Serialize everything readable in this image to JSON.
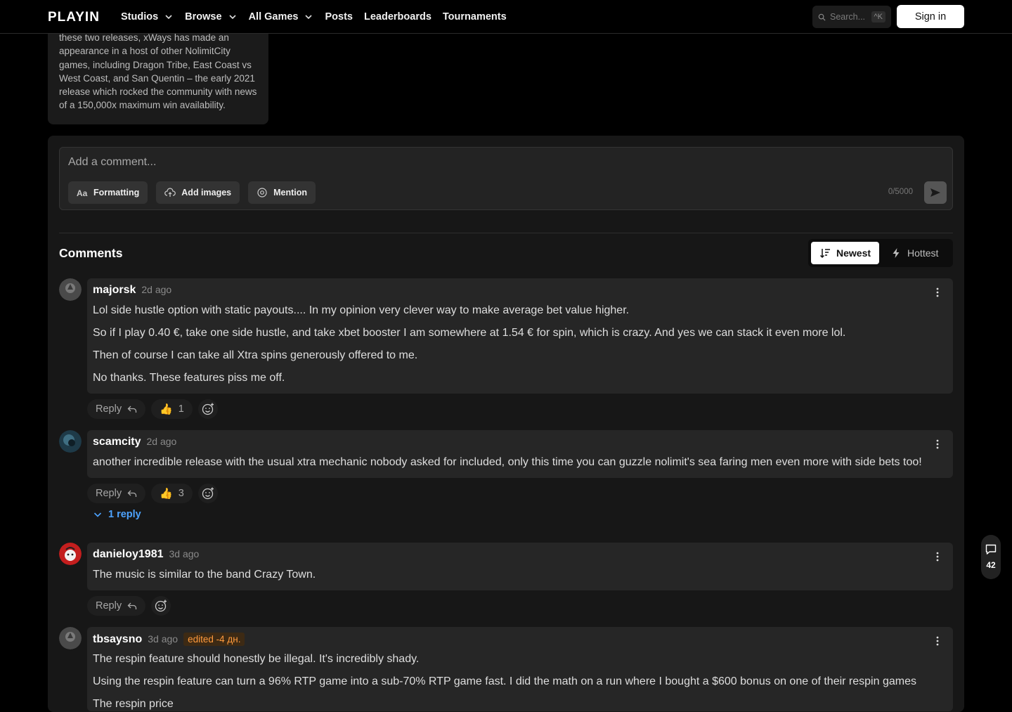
{
  "nav": {
    "logo_text": "PLAYIN",
    "links": [
      {
        "label": "Studios",
        "dropdown": true
      },
      {
        "label": "Browse",
        "dropdown": true
      },
      {
        "label": "All Games",
        "dropdown": true
      },
      {
        "label": "Posts",
        "dropdown": false
      },
      {
        "label": "Leaderboards",
        "dropdown": false
      },
      {
        "label": "Tournaments",
        "dropdown": false
      }
    ],
    "search_placeholder": "Search...",
    "search_shortcut": "^K",
    "signin_label": "Sign in"
  },
  "info_card": {
    "text": "these two releases, xWays has made an appearance in a host of other NolimitCity games, including Dragon Tribe, East Coast vs West Coast, and San Quentin – the early 2021 release which rocked the community with news of a 150,000x maximum win availability."
  },
  "composer": {
    "placeholder": "Add a comment...",
    "formatting_label": "Formatting",
    "add_images_label": "Add images",
    "mention_label": "Mention",
    "counter": "0/5000"
  },
  "comments_section": {
    "title": "Comments",
    "sort_newest": "Newest",
    "sort_hottest": "Hottest",
    "total_count": "42"
  },
  "comments": [
    {
      "user": "majorsk",
      "time": "2d ago",
      "paragraphs": [
        "Lol side hustle option with static payouts.... In my opinion very clever way to make average bet value higher.",
        "So if I play 0.40 €, take one side hustle, and take xbet booster I am somewhere at 1.54 € for spin, which is crazy. And yes we can stack it even more lol.",
        "Then of course I can take all Xtra spins generously offered to me.",
        "No thanks. These features piss me off."
      ],
      "reply_label": "Reply",
      "likes": "1"
    },
    {
      "user": "scamcity",
      "time": "2d ago",
      "paragraphs": [
        "another incredible release with the usual xtra mechanic nobody asked for included, only this time you can guzzle nolimit's sea faring men even more with side bets too!"
      ],
      "reply_label": "Reply",
      "likes": "3",
      "replies_toggle": "1 reply"
    },
    {
      "user": "danieloy1981",
      "time": "3d ago",
      "paragraphs": [
        "The music is similar to the band Crazy Town."
      ],
      "reply_label": "Reply"
    },
    {
      "user": "tbsaysno",
      "time": "3d ago",
      "edited": "edited -4 дн.",
      "paragraphs": [
        "The respin feature should honestly be illegal. It's incredibly shady.",
        "Using the respin feature can turn a 96% RTP game into a sub-70% RTP game fast. I did the math on a run where I bought a $600 bonus on one of their respin games",
        "The respin price"
      ]
    }
  ],
  "colors": {
    "accent_link": "#4da3ff",
    "edited_badge": "#ff9a3d",
    "background": "#000000",
    "panel": "#171717"
  }
}
